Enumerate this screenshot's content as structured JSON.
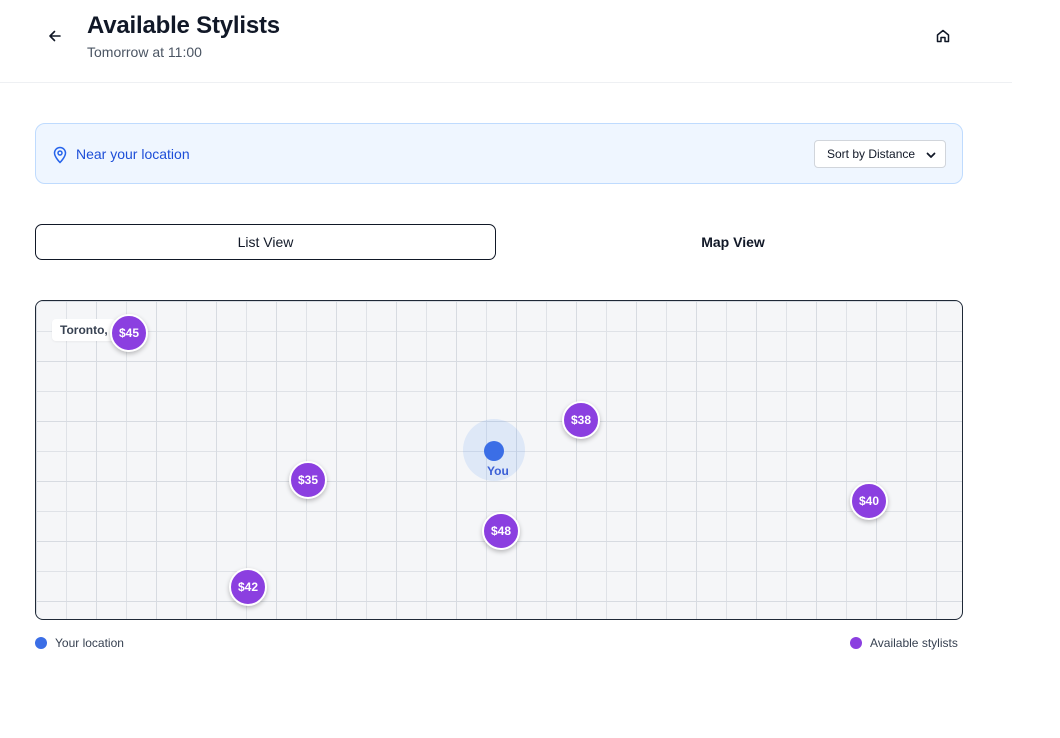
{
  "header": {
    "title": "Available Stylists",
    "subtitle": "Tomorrow at 11:00",
    "back_icon": "arrow-left-icon",
    "home_icon": "home-icon"
  },
  "location_bar": {
    "icon": "map-pin-icon",
    "text": "Near your location",
    "sort_selected": "Sort by Distance"
  },
  "tabs": {
    "list_label": "List View",
    "map_label": "Map View"
  },
  "map": {
    "city_label": "Toronto,",
    "you_label": "You",
    "stylists": [
      {
        "price": "$45"
      },
      {
        "price": "$38"
      },
      {
        "price": "$35"
      },
      {
        "price": "$48"
      },
      {
        "price": "$40"
      },
      {
        "price": "$42"
      }
    ]
  },
  "legend": {
    "your_location": "Your location",
    "available_stylists": "Available stylists"
  },
  "colors": {
    "accent_blue": "#1d4ed8",
    "you_dot": "#3b6ee6",
    "stylist_pin": "#8b3fe0"
  }
}
